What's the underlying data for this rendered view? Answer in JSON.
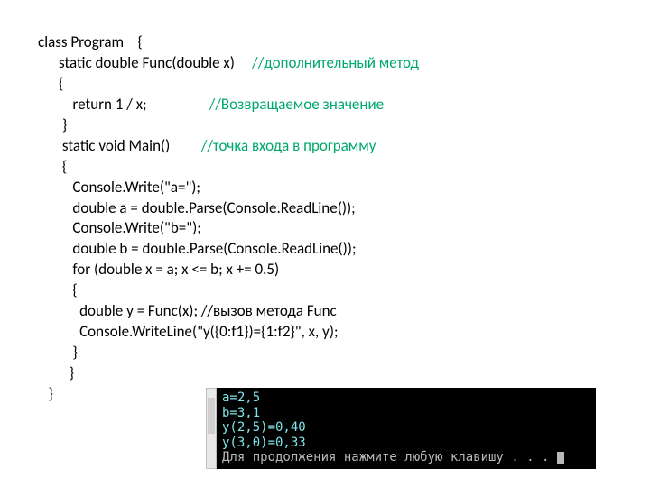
{
  "code": {
    "l1_a": "class Program    {",
    "l2_a": "      static double Func(double x)     ",
    "l2_c": "//дополнительный метод",
    "l3_a": "      {",
    "l4_a": "          return 1 / x;                  ",
    "l4_c": "//Возвращаемое значение",
    "l5_a": "       }",
    "l6_a": "       static void Main()         ",
    "l6_c": "//точка входа в программу",
    "l7_a": "       {",
    "l8_a": "          Console.Write(\"a=\");",
    "l9_a": "          double a = double.Parse(Console.ReadLine());",
    "l10_a": "          Console.Write(\"b=\");",
    "l11_a": "          double b = double.Parse(Console.ReadLine());",
    "l12_a": "          for (double x = a; x <= b; x += 0.5)",
    "l13_a": "          {",
    "l14_a": "            double y = Func(x); //вызов метода Func",
    "l15_a": "            Console.WriteLine(\"y({0:f1})={1:f2}\", x, y);",
    "l16_a": "          }",
    "l17_a": "         }",
    "l18_a": "",
    "l19_a": "   }"
  },
  "console": {
    "l1": "a=2,5",
    "l2": "b=3,1",
    "l3": "y(2,5)=0,40",
    "l4": "y(3,0)=0,33",
    "l5": "Для продолжения нажмите любую клавишу . . . "
  }
}
